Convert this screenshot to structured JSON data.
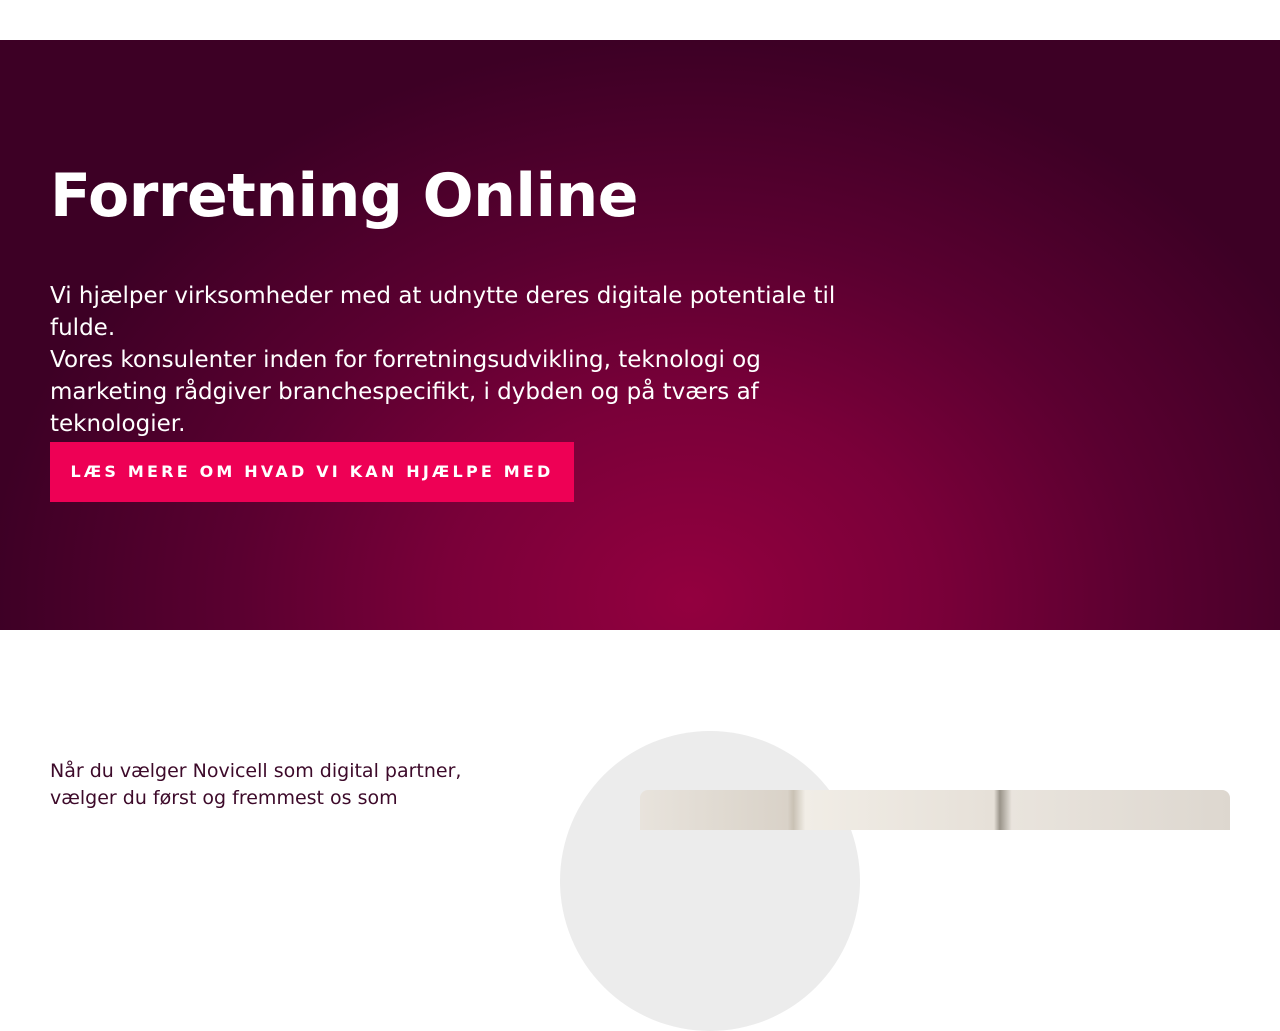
{
  "hero": {
    "title": "Forretning Online",
    "paragraph1": "Vi hjælper virksomheder med at udnytte deres digitale potentiale til fulde.",
    "paragraph2": "Vores konsulenter inden for forretningsudvikling, teknologi og marketing rådgiver branchespecifikt, i dybden og på tværs af teknologier.",
    "cta_label": "LÆS MERE OM HVAD VI KAN HJÆLPE MED"
  },
  "intro": {
    "line1": "Når du vælger Novicell som digital partner,",
    "line2": "vælger du først og fremmest os som"
  },
  "colors": {
    "hero_center": "#93003f",
    "hero_edge": "#3d0025",
    "cta_background": "#ee0055",
    "intro_text": "#3d0a2a"
  }
}
